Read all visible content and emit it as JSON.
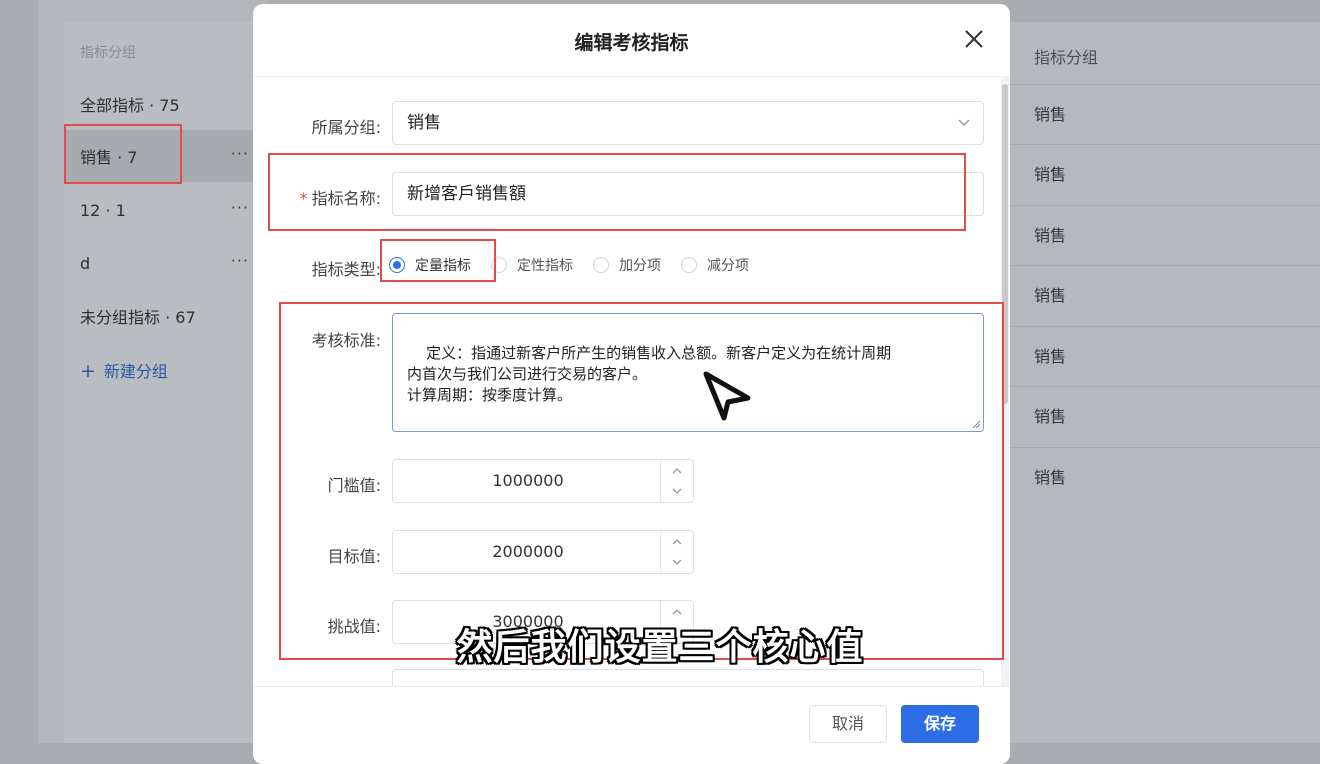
{
  "left_panel": {
    "header": "指标分组",
    "items": [
      {
        "label": "全部指标 · 75",
        "more": ""
      },
      {
        "label": "销售 · 7",
        "more": "···"
      },
      {
        "label": "12 · 1",
        "more": "···"
      },
      {
        "label": "d",
        "more": "···"
      },
      {
        "label": "未分组指标 · 67",
        "more": ""
      }
    ],
    "new_group": "新建分组"
  },
  "right_panel": {
    "header": "指标分组",
    "rows": [
      "销售",
      "销售",
      "销售",
      "销售",
      "销售",
      "销售",
      "销售"
    ]
  },
  "modal": {
    "title": "编辑考核指标",
    "fields": {
      "group_label": "所属分组:",
      "group_value": "销售",
      "name_label": "指标名称:",
      "name_required": "*",
      "name_value": "新增客戶销售額",
      "type_label": "指标类型:",
      "type_options": [
        "定量指标",
        "定性指标",
        "加分项",
        "减分项"
      ],
      "criteria_label": "考核标准:",
      "criteria_value": "定义：指通过新客户所产生的销售收入总额。新客户定义为在统计周期\n内首次与我们公司进行交易的客户。\n计算周期：按季度计算。",
      "threshold_label": "门槛值:",
      "threshold_value": "1000000",
      "target_label": "目标值:",
      "target_value": "2000000",
      "challenge_label": "挑战值:",
      "challenge_value": "3000000"
    },
    "footer": {
      "cancel": "取消",
      "save": "保存"
    }
  },
  "caption": "然后我们设置三个核心值",
  "colors": {
    "accent": "#2d6ee6",
    "highlight": "#e34a4a"
  }
}
